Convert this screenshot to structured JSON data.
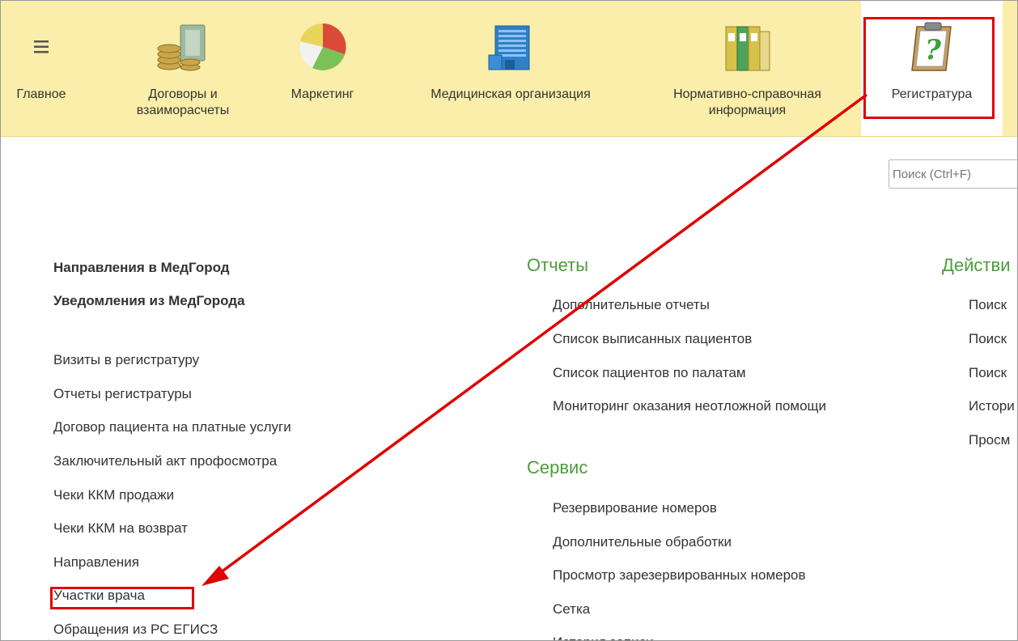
{
  "sections": [
    {
      "label": "Главное",
      "icon": "hamburger-menu-icon"
    },
    {
      "label": "Договоры и\nвзаиморасчеты",
      "icon": "coins-money-icon"
    },
    {
      "label": "Маркетинг",
      "icon": "pie-chart-icon"
    },
    {
      "label": "Медицинская организация",
      "icon": "office-building-icon"
    },
    {
      "label": "Нормативно-справочная\nинформация",
      "icon": "binders-icon"
    },
    {
      "label": "Регистратура",
      "icon": "clipboard-question-icon"
    }
  ],
  "search": {
    "placeholder": "Поиск (Ctrl+F)"
  },
  "left_column": {
    "bold_items": [
      "Направления в МедГород",
      "Уведомления из МедГорода"
    ],
    "items": [
      "Визиты в регистратуру",
      "Отчеты регистратуры",
      "Договор пациента на платные услуги",
      "Заключительный акт профосмотра",
      "Чеки ККМ продажи",
      "Чеки ККМ на возврат",
      "Направления",
      "Участки врача",
      "Обращения из РС ЕГИСЗ"
    ]
  },
  "reports": {
    "title": "Отчеты",
    "items": [
      "Дополнительные отчеты",
      "Список выписанных пациентов",
      "Список пациентов по палатам",
      "Мониторинг оказания неотложной помощи"
    ]
  },
  "service": {
    "title": "Сервис",
    "items": [
      "Резервирование номеров",
      "Дополнительные обработки",
      "Просмотр зарезервированных номеров",
      "Сетка",
      "История записи"
    ]
  },
  "actions": {
    "title": "Действи",
    "items": [
      "Поиск",
      "Поиск",
      "Поиск",
      "Истори",
      "Просм"
    ]
  },
  "colors": {
    "accent_green": "#4a9d3a",
    "highlight_red": "#e00000",
    "topbar_bg": "#fbeeaa"
  }
}
